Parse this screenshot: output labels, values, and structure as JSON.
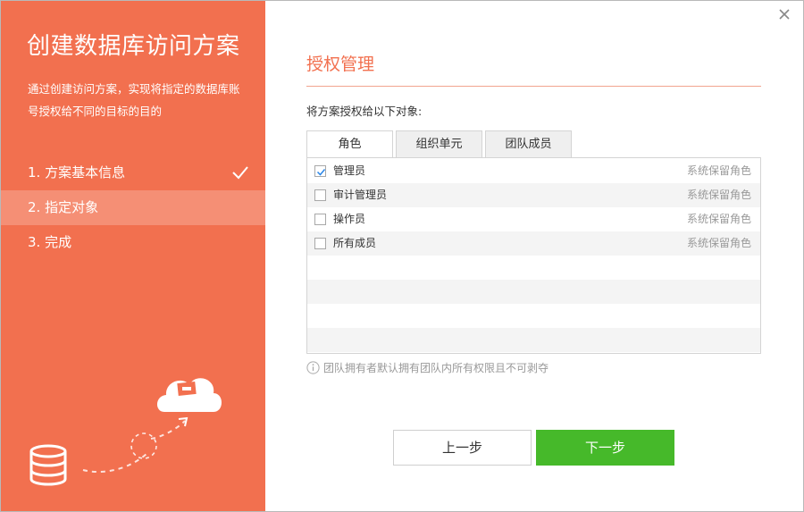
{
  "sidebar": {
    "title": "创建数据库访问方案",
    "description": "通过创建访问方案，实现将指定的数据库账号授权给不同的目标的目的",
    "steps": [
      {
        "label": "1. 方案基本信息",
        "completed": true
      },
      {
        "label": "2. 指定对象",
        "active": true
      },
      {
        "label": "3. 完成"
      }
    ]
  },
  "main": {
    "section_title": "授权管理",
    "assign_label": "将方案授权给以下对象:",
    "tabs": [
      {
        "label": "角色",
        "active": true
      },
      {
        "label": "组织单元"
      },
      {
        "label": "团队成员"
      }
    ],
    "rows": [
      {
        "name": "管理员",
        "tag": "系统保留角色",
        "checked": true
      },
      {
        "name": "审计管理员",
        "tag": "系统保留角色",
        "checked": false
      },
      {
        "name": "操作员",
        "tag": "系统保留角色",
        "checked": false
      },
      {
        "name": "所有成员",
        "tag": "系统保留角色",
        "checked": false
      }
    ],
    "note": "团队拥有者默认拥有团队内所有权限且不可剥夺"
  },
  "buttons": {
    "prev": "上一步",
    "next": "下一步"
  },
  "colors": {
    "accent": "#f2704f",
    "primary_button": "#46b92a",
    "check": "#2a86e8"
  },
  "icons": [
    "check-icon",
    "close-icon",
    "info-icon",
    "cloud-icon",
    "database-icon"
  ]
}
